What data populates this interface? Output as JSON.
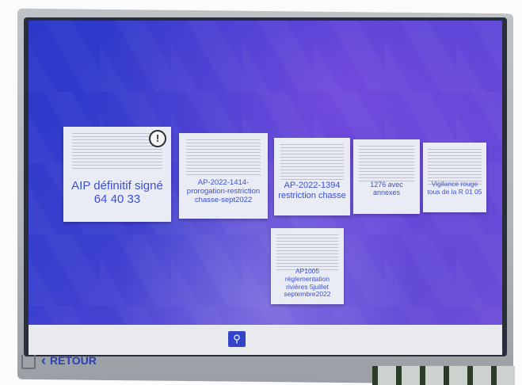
{
  "documents": [
    {
      "title": "AIP définitif signé 64 40 33",
      "has_alert": true,
      "alert_glyph": "!"
    },
    {
      "title": "AP-2022-1414- prorogation-restriction chasse-sept2022"
    },
    {
      "title": "AP-2022-1394 restriction chasse"
    },
    {
      "title": "1276 avec annexes"
    },
    {
      "title": "Vigilance rouge tous de la R 01 05"
    },
    {
      "title": "AP1005 réglementation rivières 5juillet septembre2022"
    }
  ],
  "bottom_bar": {
    "search_icon": "search-icon",
    "back_label": "RETOUR",
    "back_icon": "chevron-left-icon",
    "home_icon": "home-icon"
  },
  "colors": {
    "screen_primary": "#2a38c8",
    "screen_secondary": "#6e4fd8",
    "card_text": "#3b4fd6",
    "bar": "#e8eaee",
    "search_button": "#3344c8"
  }
}
